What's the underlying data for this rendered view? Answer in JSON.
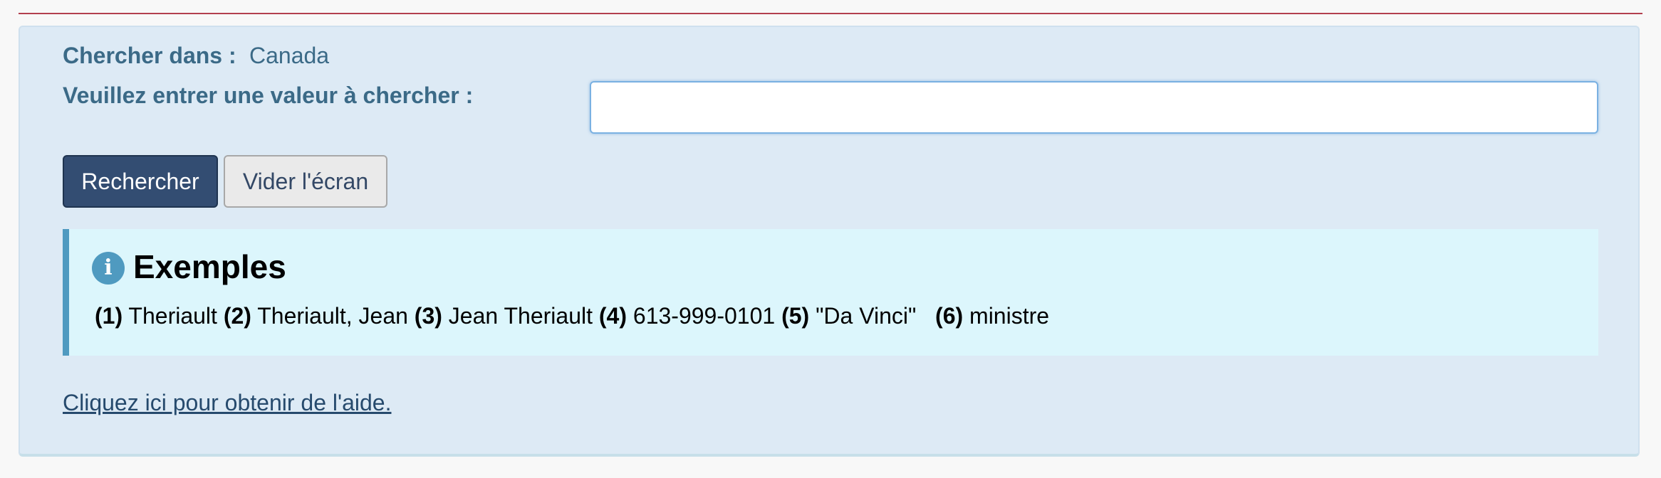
{
  "search_scope": {
    "label": "Chercher dans :",
    "value": "Canada"
  },
  "search": {
    "label": "Veuillez entrer une valeur à chercher :",
    "value": "",
    "placeholder": ""
  },
  "buttons": {
    "search_label": "Rechercher",
    "clear_label": "Vider l'écran"
  },
  "examples": {
    "icon": "info-icon",
    "icon_glyph": "i",
    "title": "Exemples",
    "items": [
      {
        "num": "(1)",
        "text": " Theriault "
      },
      {
        "num": "(2)",
        "text": " Theriault, Jean "
      },
      {
        "num": "(3)",
        "text": " Jean Theriault "
      },
      {
        "num": "(4)",
        "text": " 613-999-0101 "
      },
      {
        "num": "(5)",
        "text": " \"Da Vinci\"   "
      },
      {
        "num": "(6)",
        "text": " ministre"
      }
    ]
  },
  "help": {
    "link_text": "Cliquez ici pour obtenir de l'aide."
  },
  "colors": {
    "accent_rule": "#b3404f",
    "panel_bg": "#ddeaf5",
    "primary_button": "#334d72",
    "info_accent": "#4f9ac0",
    "label_text": "#3b6a87"
  }
}
